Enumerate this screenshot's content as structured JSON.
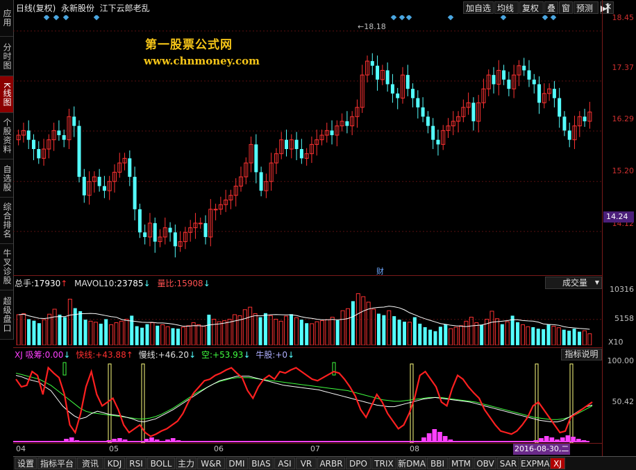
{
  "window": {
    "title_parts": [
      "日线(复权)",
      "永新股份",
      "江下云郎老乱"
    ]
  },
  "left_tabs": [
    {
      "label": "应用"
    },
    {
      "label": "分时图"
    },
    {
      "label": "K线图",
      "active": true
    },
    {
      "label": "个股资料"
    },
    {
      "label": "自选股"
    },
    {
      "label": "综合排名"
    },
    {
      "label": "牛叉诊股"
    },
    {
      "label": "超级盘口"
    }
  ],
  "toolbar": {
    "add_watch": "加自选",
    "ma_line": "均线",
    "restore": "复权",
    "overlay": "叠",
    "window": "窗",
    "forecast": "预测",
    "play_icon": "play-pause-icon",
    "close_icon": "close-icon"
  },
  "watermark": {
    "line1": "第一股票公式网",
    "line2": "www.chnmoney.com"
  },
  "price_axis": {
    "labels": [
      "18.45",
      "17.37",
      "16.29",
      "15.20",
      "14.12"
    ],
    "current": "14.24",
    "high_marker": "18.18"
  },
  "cai_marker": "财",
  "volume_panel": {
    "total_label": "总手:",
    "total_value": "17930",
    "mavol_label": "MAVOL10:",
    "mavol_value": "23785",
    "ratio_label": "量比:",
    "ratio_value": "15908",
    "selector": "成交量",
    "axis_labels": [
      "10316",
      "5158",
      "X10"
    ]
  },
  "indicator_panel": {
    "name": "XJ",
    "absorb_label": "吸筹:",
    "absorb_value": "0.00",
    "fast_label": "快线:",
    "fast_value": "+43.88",
    "slow_label": "慢线:",
    "slow_value": "+46.20",
    "short_label": "空:",
    "short_value": "+53.93",
    "bull_label": "牛股:",
    "bull_value": "+0",
    "help_button": "指标说明",
    "axis_labels": [
      "100.00",
      "50.42"
    ],
    "date_badge": "2016-08-30,二"
  },
  "x_axis": {
    "labels": [
      "04",
      "05",
      "06",
      "07",
      "08"
    ]
  },
  "bottom_tabs": [
    "设置",
    "指标平台",
    "资讯",
    "KDJ",
    "RSI",
    "BOLL",
    "主力",
    "W&R",
    "DMI",
    "BIAS",
    "ASI",
    "VR",
    "ARBR",
    "DPO",
    "TRIX",
    "新DMA",
    "BBI",
    "MTM",
    "OBV",
    "SAR",
    "EXPMA",
    "XJ"
  ],
  "bottom_active": "XJ",
  "colors": {
    "up": "#ff3232",
    "down": "#54ffff",
    "fast_line": "#ff2020",
    "slow_line": "#ffffff",
    "short_line": "#40ff40",
    "absorb": "#ff40ff",
    "signal": "#ffff80"
  },
  "chart_data": {
    "type": "candlestick",
    "ylim": [
      13.4,
      18.7
    ],
    "y_ticks": [
      18.45,
      17.37,
      16.29,
      15.2,
      14.12
    ],
    "high": 18.18,
    "closes": [
      16.2,
      16.3,
      16.1,
      15.9,
      15.7,
      15.9,
      16.1,
      16.3,
      16.2,
      16.1,
      16.6,
      16.4,
      15.3,
      14.9,
      15.2,
      15.3,
      15.1,
      15.0,
      15.2,
      15.4,
      15.6,
      15.7,
      15.3,
      14.6,
      14.1,
      14.0,
      14.3,
      13.9,
      14.0,
      14.2,
      14.1,
      13.8,
      13.9,
      14.1,
      14.2,
      14.3,
      14.3,
      14.0,
      14.6,
      14.6,
      14.7,
      14.8,
      14.9,
      15.1,
      15.3,
      15.6,
      16.0,
      15.4,
      15.0,
      15.2,
      15.6,
      15.8,
      16.1,
      15.9,
      16.1,
      15.9,
      15.7,
      15.8,
      16.0,
      16.1,
      16.2,
      16.3,
      16.2,
      16.4,
      16.5,
      16.4,
      16.6,
      16.8,
      17.5,
      17.8,
      17.7,
      17.4,
      17.6,
      17.3,
      17.1,
      17.0,
      17.5,
      17.2,
      17.0,
      16.8,
      16.6,
      16.4,
      16.1,
      16.0,
      16.3,
      16.4,
      16.5,
      16.6,
      16.8,
      16.9,
      16.5,
      16.9,
      17.2,
      17.5,
      17.3,
      17.6,
      17.4,
      17.2,
      17.5,
      17.7,
      17.6,
      17.4,
      17.3,
      16.9,
      17.1,
      17.2,
      17.0,
      16.6,
      16.3,
      16.1,
      16.4,
      16.6,
      16.5,
      16.7
    ],
    "volume_ylim": [
      0,
      10800
    ],
    "volumes": [
      6100,
      6300,
      5200,
      4900,
      4400,
      5100,
      6200,
      7200,
      6100,
      5600,
      9200,
      7400,
      6800,
      5100,
      4800,
      4600,
      4300,
      5200,
      4100,
      4500,
      4800,
      5200,
      5900,
      3800,
      3500,
      4200,
      4500,
      3900,
      4100,
      3700,
      3400,
      3300,
      3600,
      3900,
      4500,
      4100,
      3800,
      6100,
      5200,
      4700,
      4900,
      5200,
      6100,
      5900,
      7100,
      7600,
      6300,
      5600,
      6400,
      5900,
      5200,
      4800,
      5800,
      6200,
      5500,
      5100,
      4400,
      4300,
      4700,
      4900,
      5100,
      5600,
      5000,
      6900,
      7300,
      8800,
      10300,
      9700,
      8600,
      7200,
      6300,
      6000,
      6900,
      5800,
      5100,
      4700,
      4600,
      5600,
      4300,
      3600,
      3100,
      2800,
      3700,
      4200,
      3300,
      3600,
      3900,
      4800,
      5600,
      4500,
      4100,
      5200,
      6800,
      5300,
      4200,
      4700,
      5900,
      4600,
      4100,
      3700,
      3600,
      3300,
      3200,
      4200,
      3800,
      3500,
      3100,
      2900,
      3300,
      2700,
      2900,
      2300
    ],
    "fast_line": [
      80,
      70,
      72,
      90,
      85,
      60,
      95,
      88,
      82,
      60,
      20,
      10,
      35,
      70,
      90,
      60,
      45,
      50,
      55,
      40,
      20,
      10,
      15,
      20,
      10,
      5,
      8,
      12,
      15,
      20,
      25,
      35,
      50,
      62,
      70,
      78,
      80,
      85,
      88,
      92,
      95,
      88,
      82,
      65,
      55,
      70,
      80,
      85,
      80,
      90,
      88,
      92,
      95,
      90,
      85,
      80,
      78,
      82,
      86,
      90,
      88,
      80,
      70,
      58,
      40,
      30,
      45,
      60,
      50,
      35,
      25,
      15,
      20,
      35,
      55,
      85,
      90,
      80,
      70,
      50,
      45,
      68,
      85,
      80,
      70,
      62,
      55,
      40,
      30,
      20,
      12,
      10,
      8,
      12,
      20,
      30,
      45,
      50,
      40,
      30,
      20,
      10,
      12,
      30,
      35,
      40,
      45,
      50
    ],
    "slow_line": [
      85,
      83,
      80,
      78,
      76,
      70,
      65,
      55,
      45,
      38,
      32,
      28,
      30,
      35,
      38,
      36,
      34,
      33,
      32,
      30,
      28,
      25,
      24,
      26,
      28,
      32,
      36,
      40,
      45,
      50,
      55,
      60,
      65,
      70,
      74,
      78,
      80,
      82,
      84,
      84,
      84,
      82,
      80,
      78,
      76,
      74,
      72,
      71,
      70,
      69,
      68,
      67,
      66,
      64,
      62,
      60,
      58,
      56,
      54,
      52,
      50,
      48,
      46,
      45,
      44,
      44,
      46,
      48,
      50,
      52,
      54,
      55,
      56,
      55,
      54,
      53,
      52,
      51,
      50,
      48,
      46,
      44,
      42,
      40,
      38,
      36,
      34,
      32,
      30,
      28,
      26,
      25,
      24,
      24,
      26,
      30,
      35,
      40,
      44,
      46
    ],
    "short_line": [
      88,
      86,
      84,
      82,
      80,
      76,
      72,
      66,
      60,
      54,
      48,
      42,
      38,
      36,
      35,
      34,
      33,
      32,
      31,
      30,
      29,
      28,
      28,
      29,
      31,
      34,
      38,
      42,
      47,
      52,
      57,
      62,
      66,
      70,
      74,
      77,
      79,
      81,
      82,
      82,
      82,
      81,
      80,
      79,
      78,
      77,
      76,
      75,
      74,
      73,
      72,
      71,
      70,
      69,
      68,
      67,
      66,
      65,
      63,
      61,
      59,
      57,
      55,
      53,
      52,
      51,
      51,
      52,
      53,
      54,
      55,
      56,
      56,
      56,
      55,
      54,
      53,
      52,
      51,
      50,
      48,
      46,
      44,
      42,
      40,
      38,
      36,
      34,
      32,
      30,
      29,
      28,
      27,
      27,
      28,
      30,
      33,
      37,
      41,
      45
    ],
    "absorb": [
      0,
      0,
      0,
      0,
      0,
      0,
      0,
      0,
      0,
      4,
      6,
      2,
      0,
      0,
      0,
      0,
      0,
      2,
      4,
      5,
      3,
      0,
      0,
      0,
      4,
      6,
      3,
      1,
      3,
      5,
      2,
      0,
      0,
      0,
      0,
      0,
      0,
      0,
      0,
      0,
      0,
      0,
      0,
      0,
      0,
      0,
      0,
      0,
      0,
      0,
      0,
      0,
      0,
      0,
      0,
      0,
      0,
      0,
      0,
      0,
      0,
      0,
      0,
      0,
      0,
      0,
      0,
      0,
      0,
      0,
      0,
      0,
      0,
      0,
      0,
      0,
      6,
      12,
      18,
      14,
      8,
      3,
      0,
      0,
      0,
      0,
      0,
      0,
      0,
      0,
      0,
      0,
      0,
      0,
      0,
      0,
      0,
      2,
      5,
      8,
      6,
      3,
      6,
      9,
      7,
      4,
      2,
      0
    ]
  }
}
